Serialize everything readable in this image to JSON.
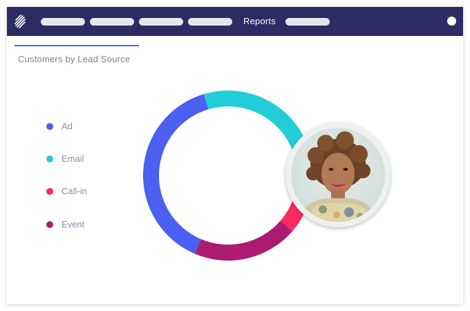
{
  "nav": {
    "active_label": "Reports"
  },
  "page": {
    "title": "Customers by Lead Source"
  },
  "colors": {
    "topbar": "#2d2b63",
    "accent": "#4b5ff0",
    "ad": "#4b5ff0",
    "email": "#22cdd7",
    "callin": "#fa2a5f",
    "event": "#ad1a72"
  },
  "icons": {
    "logo": "brand-logo-icon",
    "user": "user-avatar-icon"
  },
  "chart_data": {
    "type": "pie",
    "title": "Customers by Lead Source",
    "categories": [
      "Ad",
      "Email",
      "Call-in",
      "Event"
    ],
    "values": [
      39,
      33,
      8,
      20
    ],
    "colors": [
      "#4b5ff0",
      "#22cdd7",
      "#fa2a5f",
      "#ad1a72"
    ],
    "legend_placement": "left",
    "donut": true
  }
}
